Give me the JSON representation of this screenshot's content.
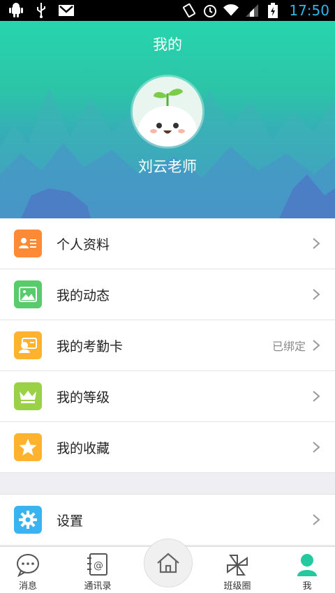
{
  "status_bar": {
    "time": "17:50"
  },
  "header": {
    "title": "我的",
    "username": "刘云老师"
  },
  "menu": [
    {
      "label": "个人资料",
      "value": "",
      "icon": "profile-card-icon",
      "color": "#ff8a35"
    },
    {
      "label": "我的动态",
      "value": "",
      "icon": "image-icon",
      "color": "#58cc6d"
    },
    {
      "label": "我的考勤卡",
      "value": "已绑定",
      "icon": "attendance-card-icon",
      "color": "#ffb22e"
    },
    {
      "label": "我的等级",
      "value": "",
      "icon": "crown-icon",
      "color": "#9ad146"
    },
    {
      "label": "我的收藏",
      "value": "",
      "icon": "star-icon",
      "color": "#ffb22e"
    }
  ],
  "settings": {
    "label": "设置",
    "icon": "gear-icon",
    "color": "#3ab4f1"
  },
  "nav": {
    "messages": "消息",
    "contacts": "通讯录",
    "class_circle": "班级圈",
    "me": "我"
  },
  "colors": {
    "header_top": "#27d5ad",
    "header_bottom": "#4c7fcf",
    "active_tab": "#25c99f"
  }
}
